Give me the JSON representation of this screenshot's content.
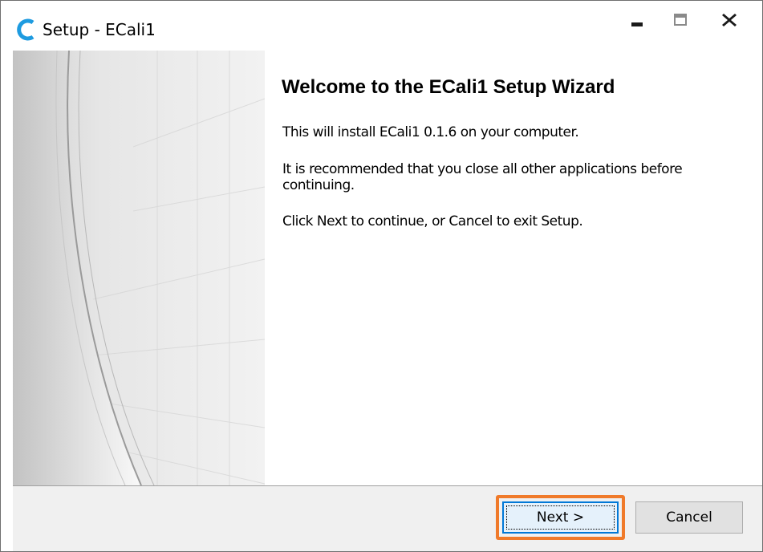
{
  "window": {
    "title": "Setup - ECali1",
    "app_icon": "ecali1-app-icon",
    "controls": {
      "minimize_icon": "minimize-icon",
      "maximize_icon": "maximize-icon",
      "close_icon": "close-icon"
    }
  },
  "sidebar": {
    "image": "wizard-banner-image"
  },
  "content": {
    "heading": "Welcome to the ECali1 Setup Wizard",
    "paragraphs": [
      "This will install ECali1 0.1.6 on your computer.",
      "It is recommended that you close all other applications before continuing.",
      "Click Next to continue, or Cancel to exit Setup."
    ]
  },
  "buttons": {
    "next_label": "Next >",
    "cancel_label": "Cancel"
  },
  "colors": {
    "highlight": "#f07a2a",
    "app_icon": "#1e9be0",
    "focus_border": "#0078d7"
  }
}
